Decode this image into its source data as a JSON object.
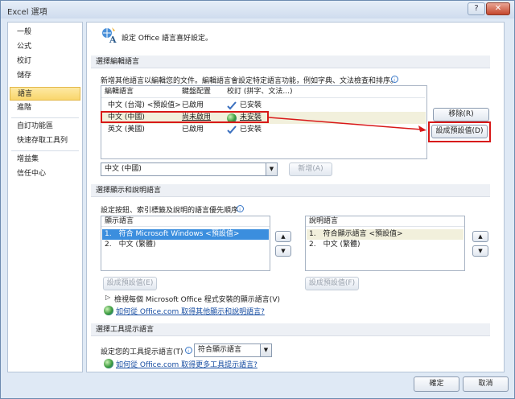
{
  "window": {
    "title": "Excel 選項",
    "help": "?",
    "close": "✕"
  },
  "sidebar": {
    "items": [
      {
        "label": "一般"
      },
      {
        "label": "公式"
      },
      {
        "label": "校訂"
      },
      {
        "label": "儲存"
      },
      {
        "label": "語言",
        "selected": true
      },
      {
        "label": "進階"
      },
      {
        "label": "自訂功能區"
      },
      {
        "label": "快速存取工具列"
      },
      {
        "label": "增益集"
      },
      {
        "label": "信任中心"
      }
    ]
  },
  "header": {
    "text": "設定 Office 語言喜好設定。",
    "icon": "language-settings-icon"
  },
  "editing": {
    "section_title": "選擇編輯語言",
    "description": "新增其他語言以編輯您的文件。編輯語言會設定特定語言功能，例如字典、文法檢查和排序。",
    "columns": [
      "編輯語言",
      "鍵盤配置",
      "校訂 (拼字、文法...)"
    ],
    "rows": [
      {
        "lang": "中文 (台灣) <預設值>",
        "kb": "已啟用",
        "proof": "已安裝",
        "proof_icon": "checkmark-icon"
      },
      {
        "lang": "中文 (中國)",
        "kb": "尚未啟用",
        "proof": "未安裝",
        "proof_icon": "globe-icon"
      },
      {
        "lang": "英文 (美國)",
        "kb": "已啟用",
        "proof": "已安裝",
        "proof_icon": "checkmark-icon"
      }
    ],
    "remove_label": "移除(R)",
    "set_default_label": "設成預設值(D)",
    "add_combo_value": "中文 (中國)",
    "add_label": "新增(A)"
  },
  "display": {
    "section_title": "選擇顯示和說明語言",
    "description": "設定按鈕、索引標籤及說明的語言優先順序",
    "display_box_title": "顯示語言",
    "display_items": [
      "1.　符合 Microsoft Windows <預設值>",
      "2.　中文 (繁體)"
    ],
    "help_box_title": "說明語言",
    "help_items": [
      "1.　符合顯示語言 <預設值>",
      "2.　中文 (繁體)"
    ],
    "set_default_left": "設成預設值(E)",
    "set_default_right": "設成預設值(F)",
    "view_installed": "檢視每個 Microsoft Office 程式安裝的顯示語言(V)",
    "link_more": "如何從 Office.com 取得其他顯示和說明語言?"
  },
  "tooltip": {
    "section_title": "選擇工具提示語言",
    "label": "設定您的工具提示語言(T)",
    "combo_value": "符合顯示語言",
    "link_more": "如何從 Office.com 取得更多工具提示語言?"
  },
  "footer": {
    "ok": "確定",
    "cancel": "取消"
  },
  "colors": {
    "annotation": "#d81818",
    "selection": "#3b8ede",
    "accent": "#f9d66c"
  }
}
